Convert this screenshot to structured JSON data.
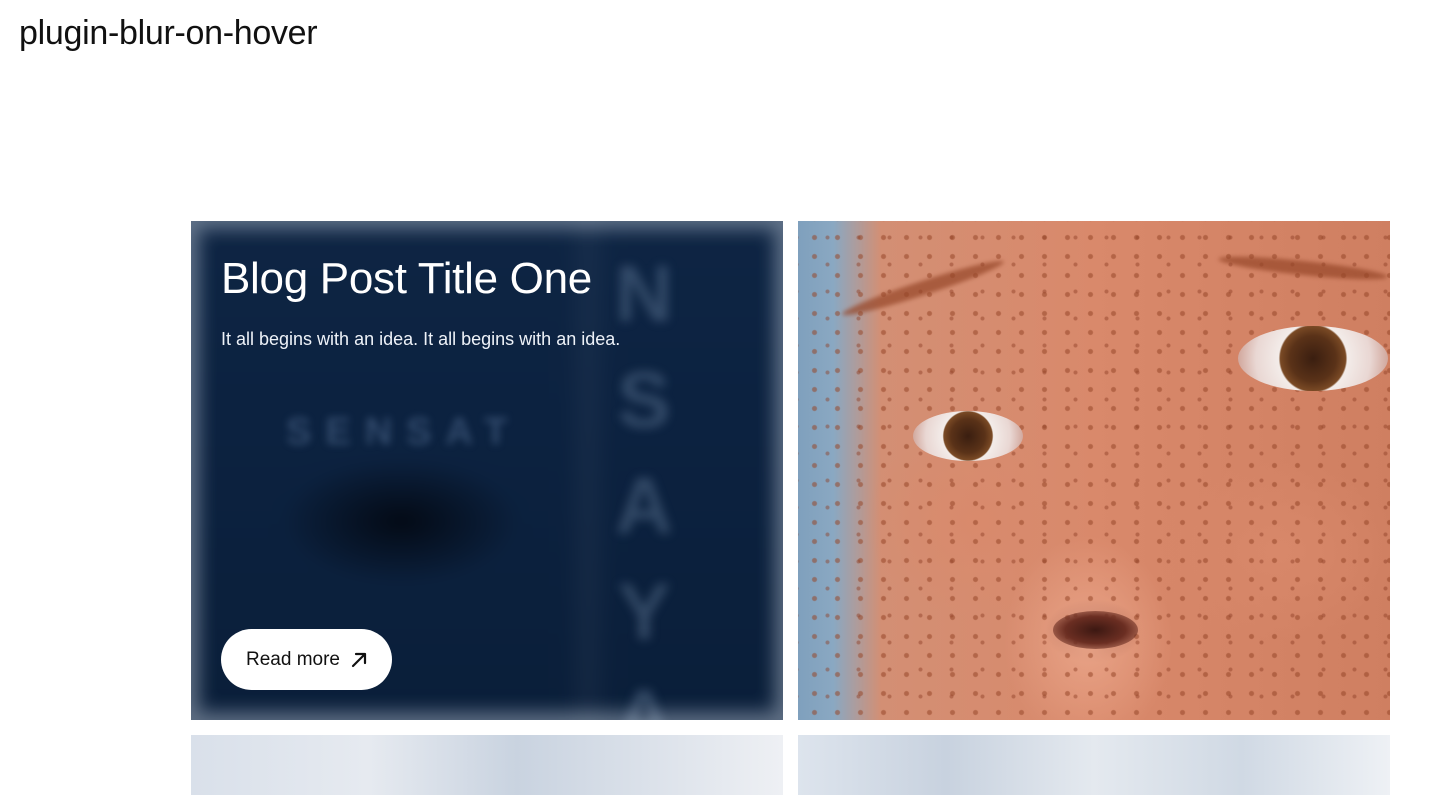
{
  "site": {
    "title": "plugin-blur-on-hover"
  },
  "posts": [
    {
      "title": "Blog Post Title One",
      "excerpt": "It all begins with an idea. It all begins with an idea.",
      "button_label": "Read more",
      "button_icon": "arrow-up-right-icon",
      "image": "blurred navy poster with vertical letters",
      "background_letters": "SENSAT",
      "vertical_letters": "NSAYA"
    }
  ]
}
